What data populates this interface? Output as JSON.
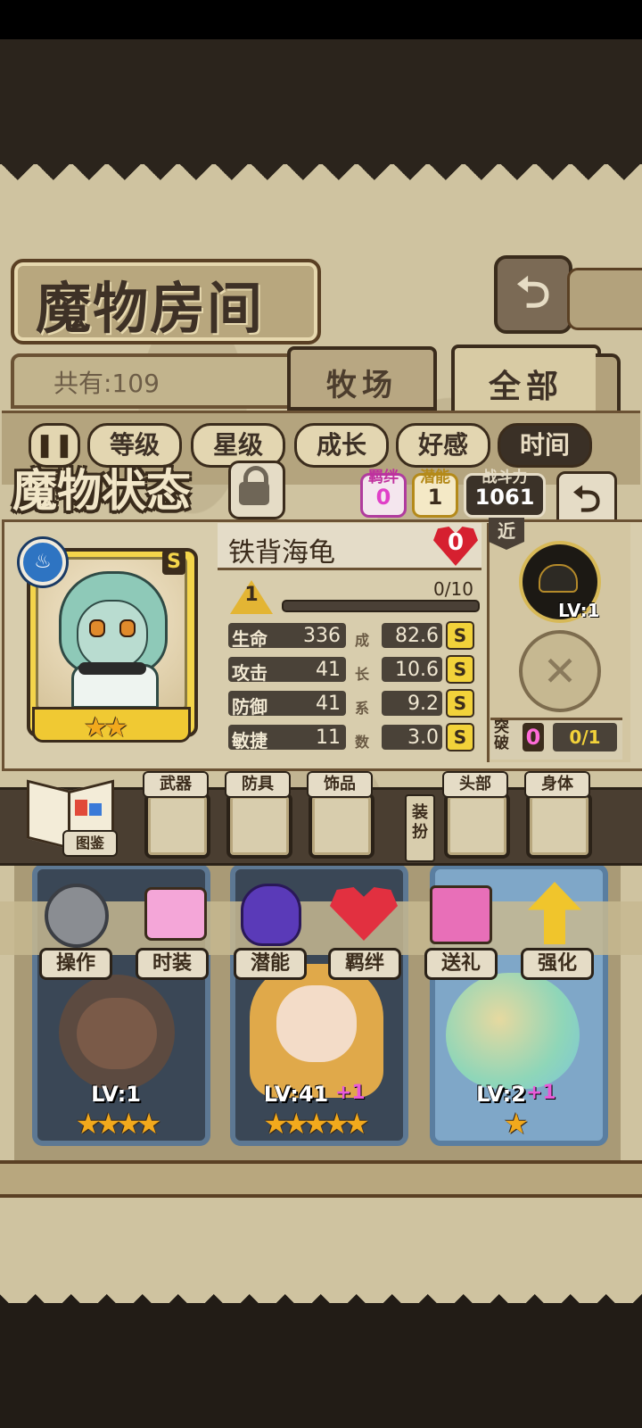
{
  "room": {
    "title": "魔物房间",
    "count_label": "共有:109",
    "tabs": [
      "牧场",
      "全部"
    ],
    "sort_buttons": [
      "等级",
      "星级",
      "成长",
      "好感",
      "时间"
    ],
    "pause_icon": "pause-icon"
  },
  "status": {
    "title": "魔物状态",
    "bond_label": "羁绊",
    "bond_value": "0",
    "potential_label": "潜能",
    "potential_value": "1",
    "power_label": "战斗力",
    "power_value": "1061",
    "colors": {
      "bond": "#f06ad8",
      "potential": "#f2c23a"
    }
  },
  "monster": {
    "name": "铁背海龟",
    "affection": "0",
    "level": "1",
    "exp": "0/10",
    "exp_progress": 0,
    "rank": "S",
    "element_icon": "water-steam-icon",
    "stars": 2,
    "stars_text": "★★",
    "stats": [
      {
        "name": "生命",
        "value": "336",
        "growth": "82.6",
        "grade": "S"
      },
      {
        "name": "攻击",
        "value": "41",
        "growth": "10.6",
        "grade": "S"
      },
      {
        "name": "防御",
        "value": "41",
        "growth": "9.2",
        "grade": "S"
      },
      {
        "name": "敏捷",
        "value": "11",
        "growth": "3.0",
        "grade": "S"
      }
    ],
    "growth_chars": [
      "成",
      "长",
      "系",
      "数"
    ]
  },
  "skill": {
    "range_tag": "近",
    "level": "LV:1",
    "empty_icon": "✕"
  },
  "breakthrough": {
    "label": "突破",
    "value": "0",
    "progress": "0/1"
  },
  "equipment": {
    "slots": [
      "武器",
      "防具",
      "饰品",
      "头部",
      "身体"
    ],
    "dress_label": "装扮",
    "book_label": "图鉴"
  },
  "actions": [
    "操作",
    "时装",
    "潜能",
    "羁绊",
    "送礼",
    "强化"
  ],
  "cards": [
    {
      "level": "LV:1",
      "plus": "",
      "stars": "★★★★"
    },
    {
      "level": "LV:41",
      "plus": "+1",
      "stars": "★★★★★"
    },
    {
      "level": "LV:2",
      "plus": "+1",
      "stars": "★"
    }
  ],
  "partial_levels": [
    "LV:1",
    "LV:1",
    "LV:1"
  ]
}
